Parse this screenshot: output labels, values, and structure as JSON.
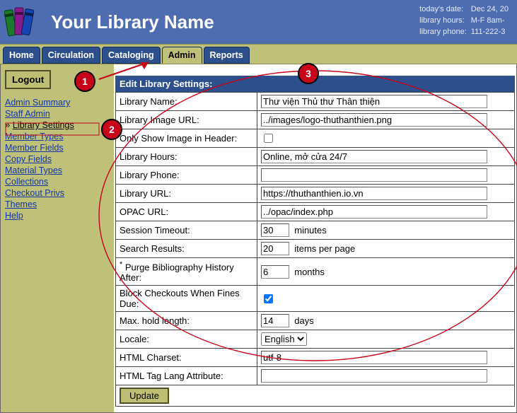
{
  "banner": {
    "title": "Your Library Name",
    "meta": {
      "date_label": "today's date:",
      "date_value": "Dec 24, 20",
      "hours_label": "library hours:",
      "hours_value": "M-F 8am-",
      "phone_label": "library phone:",
      "phone_value": "111-222-3"
    }
  },
  "tabs": {
    "home": "Home",
    "circulation": "Circulation",
    "cataloging": "Cataloging",
    "admin": "Admin",
    "reports": "Reports"
  },
  "sidebar": {
    "logout": "Logout",
    "items": [
      {
        "label": "Admin Summary"
      },
      {
        "label": "Staff Admin"
      },
      {
        "label": "Library Settings"
      },
      {
        "label": "Member Types"
      },
      {
        "label": "Member Fields"
      },
      {
        "label": "Copy Fields"
      },
      {
        "label": "Material Types"
      },
      {
        "label": "Collections"
      },
      {
        "label": "Checkout Privs"
      },
      {
        "label": "Themes"
      },
      {
        "label": "Help"
      }
    ]
  },
  "form": {
    "heading": "Edit Library Settings:",
    "labels": {
      "name": "Library Name:",
      "image_url": "Library Image URL:",
      "only_image": "Only Show Image in Header:",
      "hours": "Library Hours:",
      "phone": "Library Phone:",
      "url": "Library URL:",
      "opac_url": "OPAC URL:",
      "session_timeout": "Session Timeout:",
      "search_results": "Search Results:",
      "purge": "Purge Bibliography History After:",
      "block_checkouts": "Block Checkouts When Fines Due:",
      "max_hold": "Max. hold length:",
      "locale": "Locale:",
      "charset": "HTML Charset:",
      "lang_attr": "HTML Tag Lang Attribute:"
    },
    "values": {
      "name": "Thư viện Thủ thư Thân thiện",
      "image_url": "../images/logo-thuthanthien.png",
      "only_image_checked": false,
      "hours": "Online, mở cửa 24/7",
      "phone": "",
      "url": "https://thuthanthien.io.vn",
      "opac_url": "../opac/index.php",
      "session_timeout": "30",
      "search_results": "20",
      "purge": "6",
      "block_checkouts_checked": true,
      "max_hold": "14",
      "locale": "English",
      "charset": "utf-8",
      "lang_attr": ""
    },
    "units": {
      "minutes": "minutes",
      "items_per_page": "items per page",
      "months": "months",
      "days": "days"
    },
    "update": "Update"
  },
  "annotations": {
    "1": "1",
    "2": "2",
    "3": "3"
  }
}
